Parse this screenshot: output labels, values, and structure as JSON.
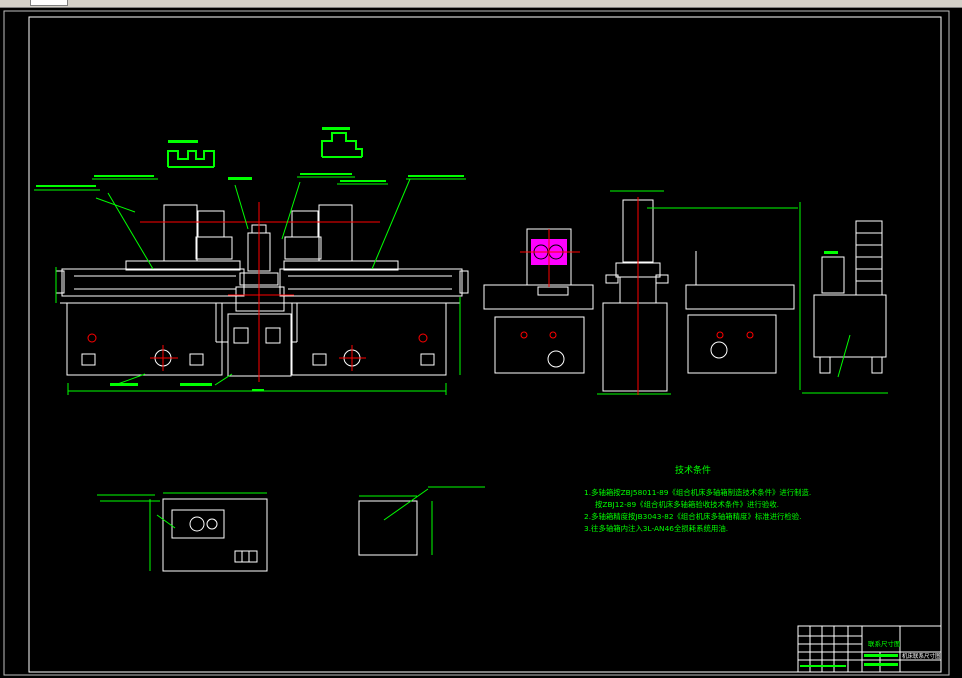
{
  "window": {
    "title": ""
  },
  "tech_requirements": {
    "heading": "技术条件",
    "lines": [
      "1.多轴箱按ZBJ58011-89《组合机床多轴箱制造技术条件》进行制造.",
      "按ZBJ12-89《组合机床多轴箱验收技术条件》进行验收.",
      "2.多轴箱精度按JB3043-82《组合机床多轴箱精度》标准进行检验.",
      "3.往多轴箱内注入3L-AN46全损耗系统用油."
    ]
  },
  "title_block": {
    "drawing_name": "联系尺寸图",
    "subtitle": "机床联系尺寸图"
  },
  "colors": {
    "background": "#000000",
    "white": "#ffffff",
    "green": "#00ff00",
    "red": "#ff0000",
    "magenta": "#ff00ff",
    "frame_gray": "#c0c0c0"
  }
}
